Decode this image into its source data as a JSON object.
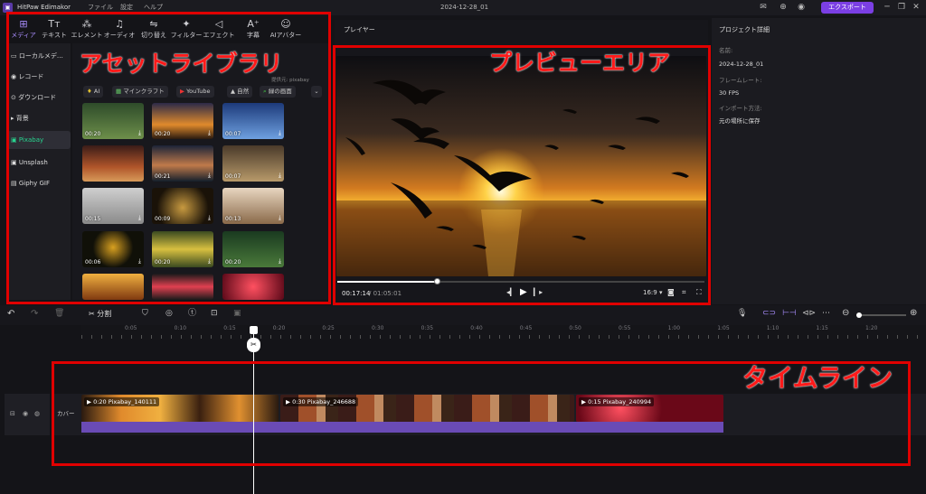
{
  "app": {
    "name": "HitPaw Edimakor",
    "project_title": "2024-12-28_01",
    "export_label": "エクスポート"
  },
  "menu": [
    "ファイル",
    "設定",
    "ヘルプ"
  ],
  "tool_tabs": [
    {
      "label": "メディア",
      "icon": "media-icon"
    },
    {
      "label": "テキスト",
      "icon": "text-icon"
    },
    {
      "label": "エレメント",
      "icon": "element-icon"
    },
    {
      "label": "オーディオ",
      "icon": "audio-icon"
    },
    {
      "label": "切り替え",
      "icon": "transition-icon"
    },
    {
      "label": "フィルター",
      "icon": "filter-icon"
    },
    {
      "label": "エフェクト",
      "icon": "effect-icon"
    },
    {
      "label": "字幕",
      "icon": "subtitle-icon"
    },
    {
      "label": "AIアバター",
      "icon": "avatar-icon"
    }
  ],
  "left_nav": [
    {
      "label": "ローカルメデ…",
      "icon": "folder-icon"
    },
    {
      "label": "レコード",
      "icon": "record-icon"
    },
    {
      "label": "ダウンロード",
      "icon": "download-icon"
    },
    {
      "label": "背景",
      "icon": "triangle-icon"
    },
    {
      "label": "Pixabay",
      "icon": "pixabay-icon"
    },
    {
      "label": "Unsplash",
      "icon": "unsplash-icon"
    },
    {
      "label": "Giphy GIF",
      "icon": "gif-icon"
    }
  ],
  "library": {
    "provider_note": "提供元:",
    "provider": "pixabay",
    "chips": [
      "AI",
      "マインクラフト",
      "YouTube",
      "自然",
      "緑の画面"
    ],
    "thumbs": [
      {
        "dur": "00:20",
        "bg": "linear-gradient(#2e4b2a,#6d8f4a)"
      },
      {
        "dur": "00:20",
        "bg": "linear-gradient(#2c2a48,#e08a2c 60%,#2a1a10)"
      },
      {
        "dur": "00:07",
        "bg": "linear-gradient(#1d3a7a,#6ea0e0)"
      },
      {
        "dur": "",
        "bg": "linear-gradient(#3a1c18,#b0552a 60%,#d89a5a)"
      },
      {
        "dur": "00:21",
        "bg": "linear-gradient(#1c2438,#c07a4a 55%,#14202c)"
      },
      {
        "dur": "00:07",
        "bg": "linear-gradient(#4a3a2a,#b89a6a)"
      },
      {
        "dur": "00:15",
        "bg": "linear-gradient(#cfcfcf,#8a8a8a)"
      },
      {
        "dur": "00:09",
        "bg": "radial-gradient(circle at 50% 55%,#c89a40,#1a1208 70%)"
      },
      {
        "dur": "00:13",
        "bg": "linear-gradient(#e8d6c0,#8a6a4a)"
      },
      {
        "dur": "00:06",
        "bg": "radial-gradient(circle at 50% 45%,#d8a020,#101008 55%)"
      },
      {
        "dur": "00:20",
        "bg": "linear-gradient(#3a4a20,#d8c040 50%,#3a4a20)"
      },
      {
        "dur": "00:20",
        "bg": "linear-gradient(#1a3a20,#4a7a3a)"
      },
      {
        "dur": "",
        "bg": "linear-gradient(#f0b040,#803a10)"
      },
      {
        "dur": "",
        "bg": "linear-gradient(#1a1a1a,#e04050 50%,#1a1a1a)"
      },
      {
        "dur": "",
        "bg": "radial-gradient(circle,#ff5060,#5a0818)"
      }
    ]
  },
  "player": {
    "title": "プレイヤー",
    "current_time": "00:17:14",
    "total_time": "/ 01:05:01",
    "aspect": "16:9 ▾",
    "progress": 0.27
  },
  "details": {
    "title": "プロジェクト詳細",
    "fields": [
      {
        "label": "名前:",
        "value": "2024-12-28_01"
      },
      {
        "label": "フレームレート:",
        "value": "30 FPS"
      },
      {
        "label": "インポート方法:",
        "value": "元の場所に保存"
      }
    ]
  },
  "timeline_toolbar": {
    "split_label": "分割"
  },
  "ruler": [
    "0:05",
    "0:10",
    "0:15",
    "0:20",
    "0:25",
    "0:30",
    "0:35",
    "0:40",
    "0:45",
    "0:50",
    "0:55",
    "1:00",
    "1:05",
    "1:10",
    "1:15",
    "1:20"
  ],
  "track": {
    "cover_label": "カバー"
  },
  "clips": [
    {
      "label": "0:20 Pixabay_140111",
      "bg": "linear-gradient(90deg,#2a1a10,#e08a2c 20%,#f0b040 40%,#3a2010 60%,#e09030 80%,#2a1a10)"
    },
    {
      "label": "0:30 Pixabay_246688",
      "bg": "repeating-linear-gradient(90deg,#3a1c18 0 20px,#a0502a 20px 40px,#c08a60 40px 50px,#3a2418 50px 64px)"
    },
    {
      "label": "0:15 Pixabay_240994",
      "bg": "radial-gradient(circle at 30% 50%,#ff5060,#6a0818 40%),radial-gradient(circle at 70% 40%,#ff4050,#5a0818 40%)"
    }
  ],
  "annotations": {
    "library": "アセットライブラリ",
    "preview": "プレビューエリア",
    "timeline": "タイムライン"
  }
}
